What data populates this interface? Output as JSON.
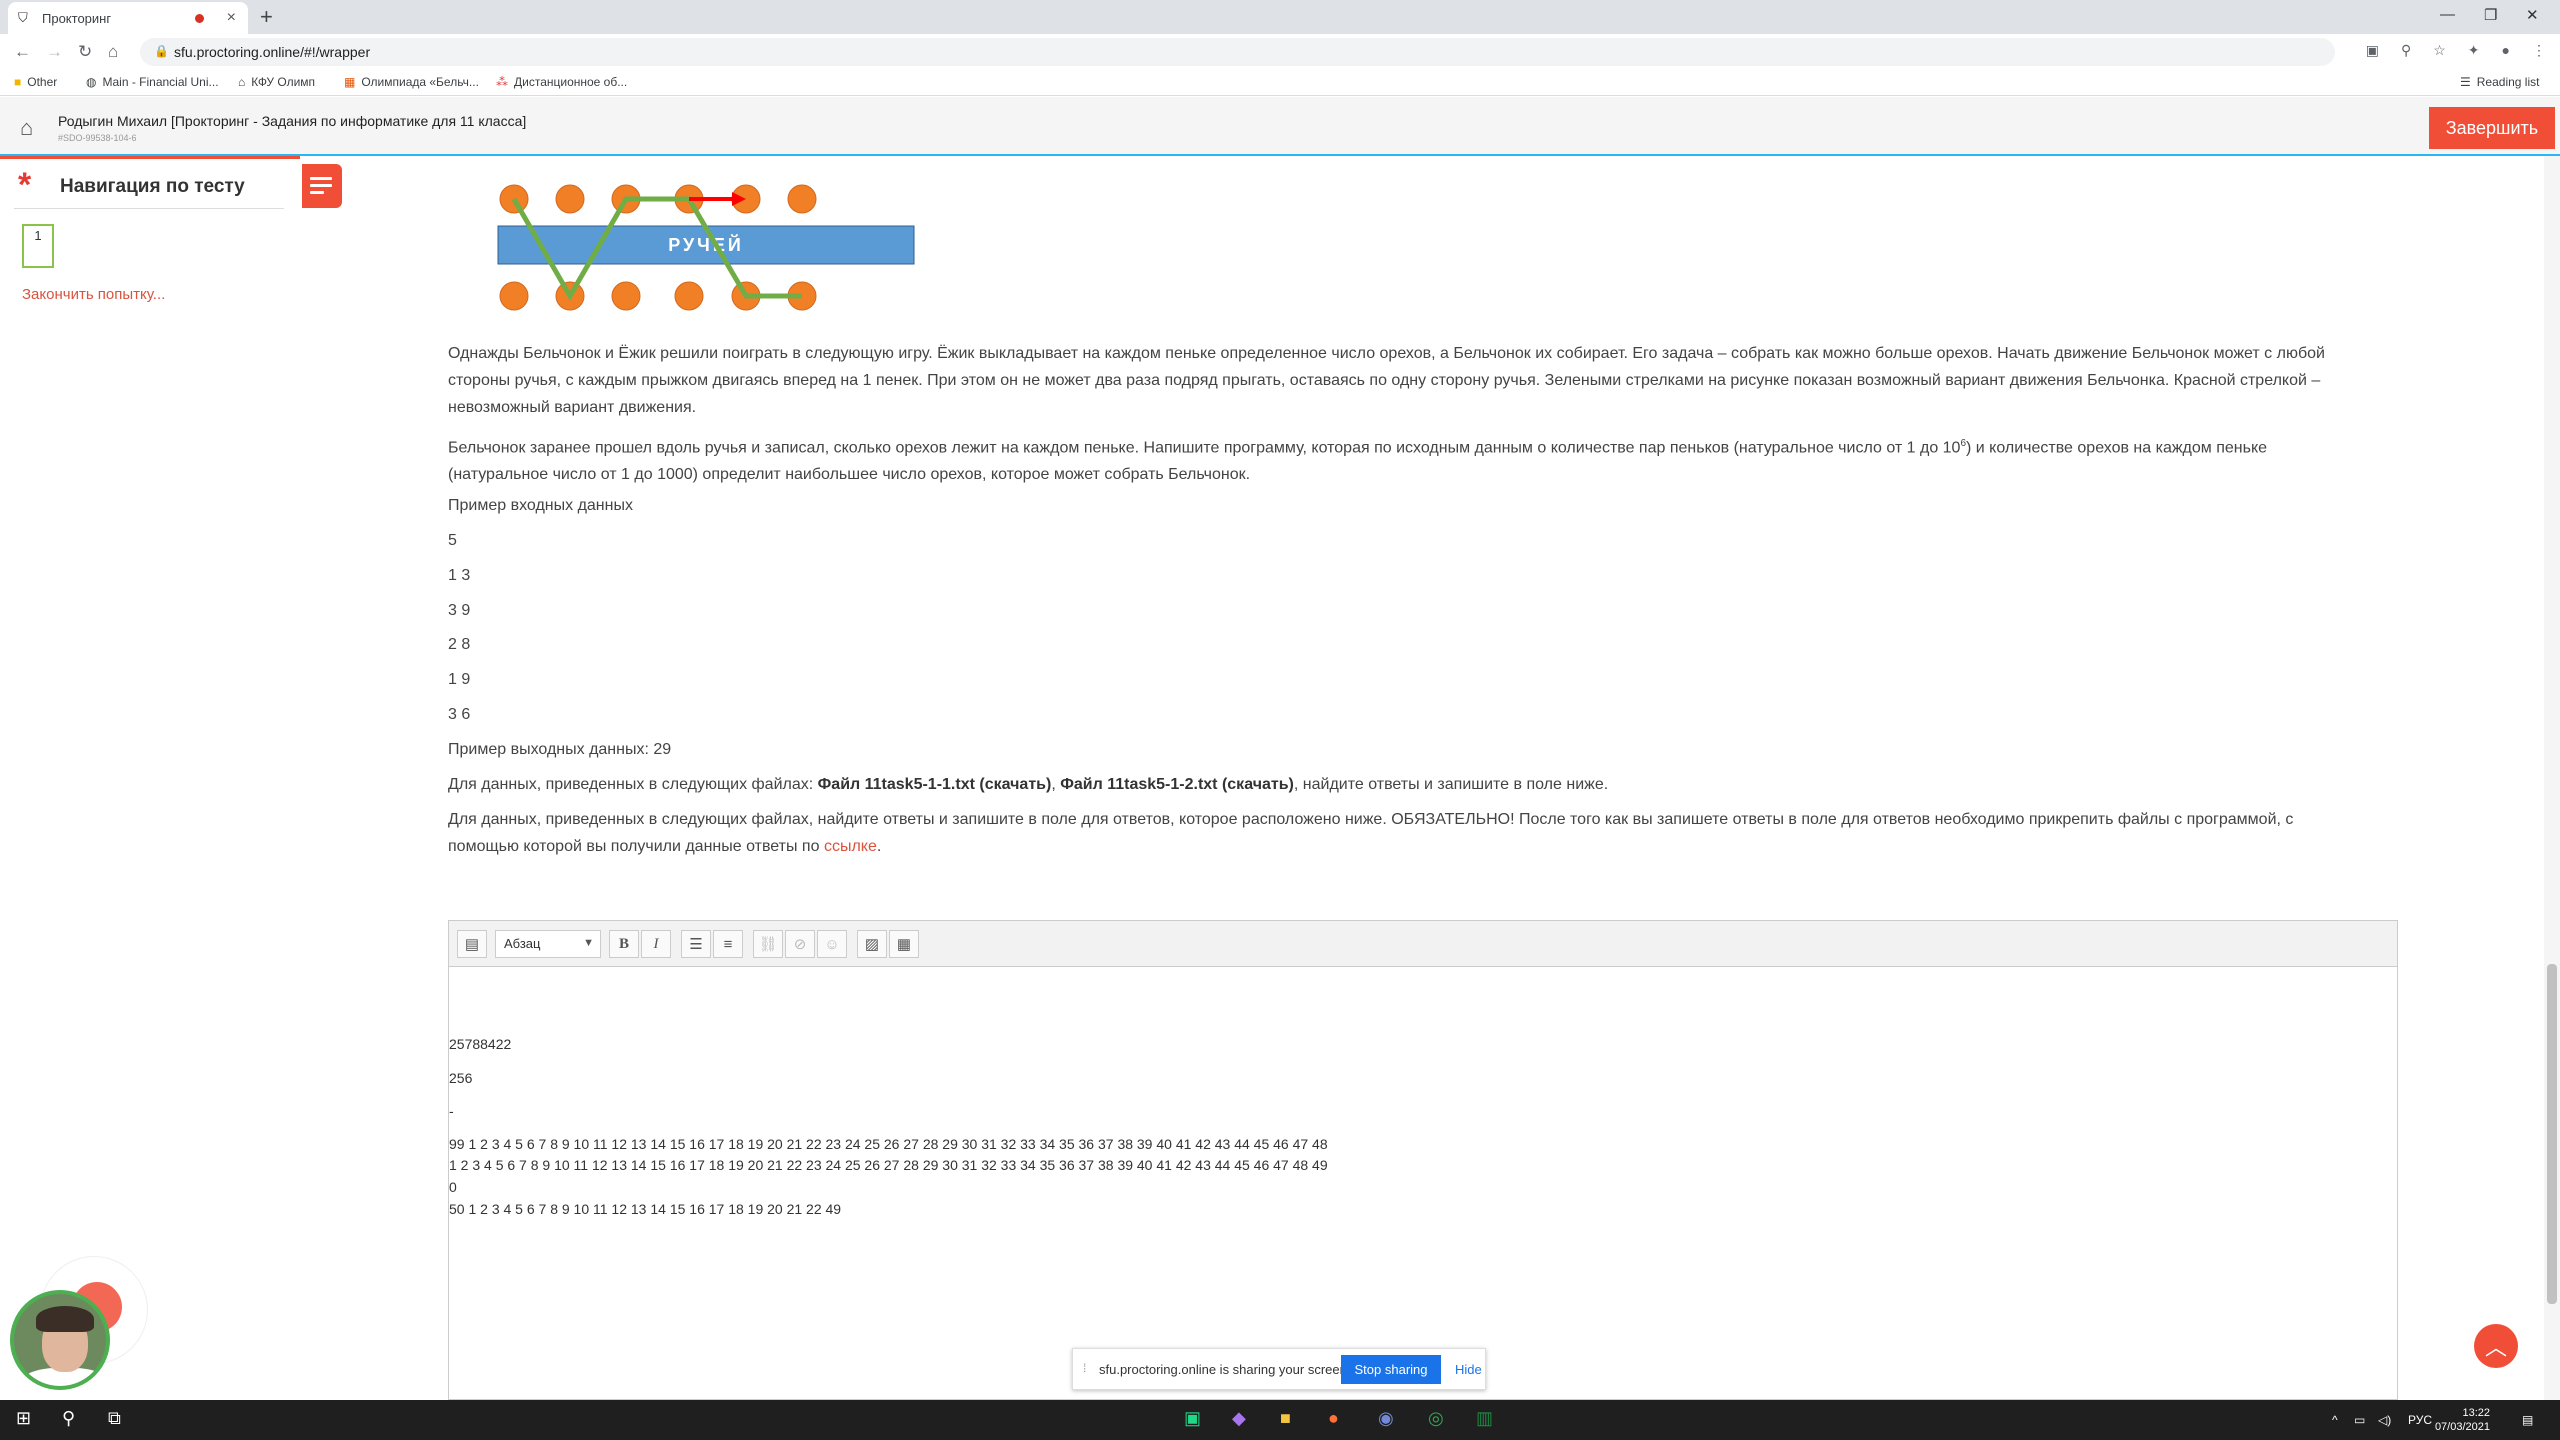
{
  "browser": {
    "tab_title": "Прокторинг",
    "url": "sfu.proctoring.online/#!/wrapper",
    "bookmarks": [
      "Other",
      "Main - Financial Uni...",
      "КФУ Олимп",
      "Олимпиада «Бельч...",
      "Дистанционное об..."
    ],
    "reading_list": "Reading list"
  },
  "header": {
    "title": "Родыгин Михаил [Прокторинг - Задания по информатике для 11 класса]",
    "subtitle": "#SDO-99538-104-6",
    "finish_button": "Завершить"
  },
  "nav": {
    "title": "Навигация по тесту",
    "question_number": "1",
    "finish_attempt": "Закончить попытку..."
  },
  "diagram": {
    "label": "РУЧЕЙ"
  },
  "problem": {
    "p1": "Однажды Бельчонок и Ёжик решили поиграть в следующую игру. Ёжик выкладывает на каждом пеньке определенное число орехов, а Бельчонок их собирает. Его задача – собрать как можно больше орехов. Начать движение Бельчонок может с любой стороны ручья, с каждым прыжком двигаясь вперед на 1 пенек. При этом он не может два раза подряд прыгать, оставаясь по одну сторону ручья. Зелеными стрелками на рисунке показан возможный вариант движения Бельчонка. Красной стрелкой – невозможный вариант движения.",
    "p2_a": "Бельчонок заранее прошел вдоль ручья и записал, сколько орехов лежит на каждом пеньке. Напишите программу, которая по исходным данным о количестве пар пеньков (натуральное число от 1 до 10",
    "p2_sup": "6",
    "p2_b": ") и количестве орехов на каждом пеньке (натуральное число от 1 до 1000) определит наибольшее число орехов, которое может собрать Бельчонок.",
    "input_label": "Пример входных данных",
    "input_lines": [
      "5",
      "1 3",
      "3 9",
      "2 8",
      "1 9",
      "3 6"
    ],
    "output_label": "Пример выходных данных: 29",
    "files_prefix": "Для данных, приведенных в следующих файлах: ",
    "file1": "Файл 11task5-1-1.txt",
    "file2": "Файл 11task5-1-2.txt",
    "download": "скачать",
    "files_suffix": ", найдите ответы и запишите в поле ниже.",
    "p_final": "Для данных, приведенных в следующих файлах, найдите ответы и запишите в поле для ответов, которое расположено ниже. ОБЯЗАТЕЛЬНО! После того как вы запишете ответы в поле для ответов необходимо прикрепить файлы с программой, с помощью которой вы получили данные ответы по ",
    "p_final_link": "ссылке",
    "p_final_end": "."
  },
  "editor": {
    "format": "Абзац",
    "lines": [
      "25788422",
      "256",
      "-",
      "99 1 2 3 4 5 6 7 8 9 10 11 12 13 14 15 16 17 18 19 20 21 22 23 24 25 26 27 28 29 30 31 32 33 34 35 36 37 38 39 40 41 42 43 44 45 46 47 48",
      "1 2 3 4 5 6 7 8 9 10 11 12 13 14 15 16 17 18 19 20 21 22 23 24 25 26 27 28 29 30 31 32 33 34 35 36 37 38 39 40 41 42 43 44 45 46 47 48 49",
      "0",
      "50 1 2 3 4 5 6 7 8 9 10 11 12 13 14 15 16 17 18 19 20 21 22 49"
    ]
  },
  "share": {
    "message": "sfu.proctoring.online is sharing your screen.",
    "stop": "Stop sharing",
    "hide": "Hide"
  },
  "taskbar": {
    "lang": "РУС",
    "time": "13:22",
    "date": "07/03/2021"
  },
  "colors": {
    "accent": "#f04e37",
    "link": "#d9533e",
    "brand_blue": "#29b6f6"
  }
}
